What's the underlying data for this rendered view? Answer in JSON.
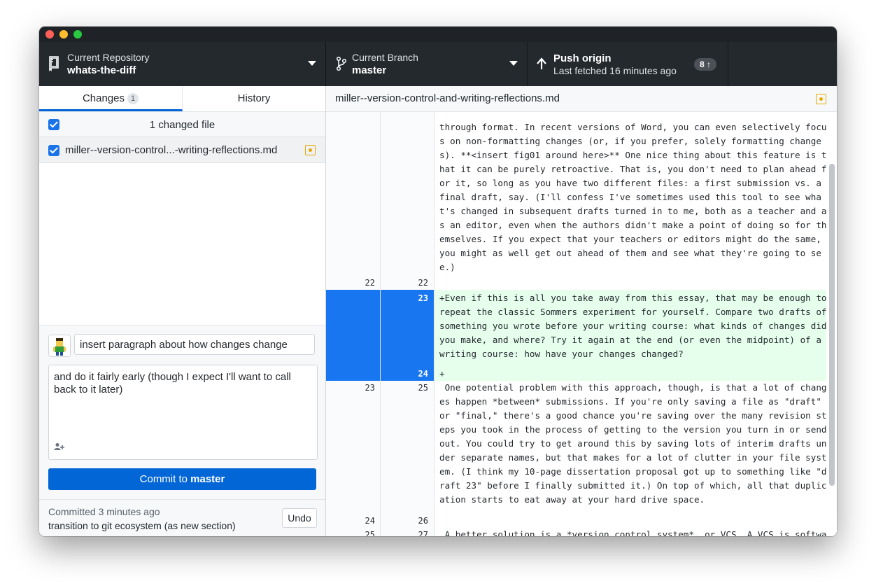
{
  "toolbar": {
    "repo_label": "Current Repository",
    "repo_name": "whats-the-diff",
    "branch_label": "Current Branch",
    "branch_name": "master",
    "push_title": "Push origin",
    "push_subtitle": "Last fetched 16 minutes ago",
    "push_badge": "8 ↑"
  },
  "tabs": {
    "changes": "Changes",
    "changes_count": "1",
    "history": "History"
  },
  "changes": {
    "header": "1 changed file",
    "files": [
      {
        "name": "miller--version-control...-writing-reflections.md",
        "checked": true,
        "status": "modified"
      }
    ]
  },
  "commit": {
    "summary": "insert paragraph about how changes change",
    "description": "and do it fairly early (though I expect I'll want to call back to it later)",
    "button_prefix": "Commit to ",
    "button_branch": "master",
    "last_time": "Committed 3 minutes ago",
    "last_message": "transition to git ecosystem (as new section)",
    "undo": "Undo"
  },
  "diff": {
    "filename": "miller--version-control-and-writing-reflections.md",
    "lines": [
      {
        "old": "",
        "new": "",
        "text": "through format. In recent versions of Word, you can even selectively focu"
      },
      {
        "old": "",
        "new": "",
        "text": "s on non-formatting changes (or, if you prefer, solely formatting change"
      },
      {
        "old": "",
        "new": "",
        "text": "s). **<insert fig01 around here>** One nice thing about this feature is t"
      },
      {
        "old": "",
        "new": "",
        "text": "hat it can be purely retroactive. That is, you don't need to plan ahead f"
      },
      {
        "old": "",
        "new": "",
        "text": "or it, so long as you have two different files: a first submission vs. a"
      },
      {
        "old": "",
        "new": "",
        "text": "final draft, say. (I'll confess I've sometimes used this tool to see wha"
      },
      {
        "old": "",
        "new": "",
        "text": "t's changed in subsequent drafts turned in to me, both as a teacher and a"
      },
      {
        "old": "",
        "new": "",
        "text": "s an editor, even when the authors didn't make a point of doing so for th"
      },
      {
        "old": "",
        "new": "",
        "text": "emselves. If you expect that your teachers or editors might do the same,"
      },
      {
        "old": "",
        "new": "",
        "text": "you might as well get out ahead of them and see what they're going to se"
      },
      {
        "old": "",
        "new": "",
        "text": "e.)"
      },
      {
        "old": "22",
        "new": "22",
        "text": ""
      },
      {
        "old": "",
        "new": "23",
        "text": "+Even if this is all you take away from this essay, that may be enough to"
      },
      {
        "old": "",
        "new": "",
        "text": "repeat the classic Sommers experiment for yourself. Compare two drafts of"
      },
      {
        "old": "",
        "new": "",
        "text": "something you wrote before your writing course: what kinds of changes did"
      },
      {
        "old": "",
        "new": "",
        "text": "you make, and where? Try it again at the end (or even the midpoint) of a"
      },
      {
        "old": "",
        "new": "",
        "text": "writing course: how have your changes changed?"
      },
      {
        "old": "",
        "new": "24",
        "text": "+"
      },
      {
        "old": "23",
        "new": "25",
        "text": " One potential problem with this approach, though, is that a lot of chang"
      },
      {
        "old": "",
        "new": "",
        "text": "es happen *between* submissions. If you're only saving a file as \"draft\""
      },
      {
        "old": "",
        "new": "",
        "text": "or \"final,\" there's a good chance you're saving over the many revision st"
      },
      {
        "old": "",
        "new": "",
        "text": "eps you took in the process of getting to the version you turn in or send"
      },
      {
        "old": "",
        "new": "",
        "text": "out. You could try to get around this by saving lots of interim drafts un"
      },
      {
        "old": "",
        "new": "",
        "text": "der separate names, but that makes for a lot of clutter in your file syst"
      },
      {
        "old": "",
        "new": "",
        "text": "em. (I think my 10-page dissertation proposal got up to something like \"d"
      },
      {
        "old": "",
        "new": "",
        "text": "raft 23\" before I finally submitted it.) On top of which, all that duplic"
      },
      {
        "old": "",
        "new": "",
        "text": "ation starts to eat away at your hard drive space."
      },
      {
        "old": "24",
        "new": "26",
        "text": ""
      },
      {
        "old": "25",
        "new": "27",
        "text": " A better solution is a *version control system*, or VCS. A VCS is softwa"
      }
    ]
  },
  "colors": {
    "accent": "#0366d6",
    "added_bg": "#e6ffed",
    "selected_hunk": "#1976f1",
    "modified": "#e6a700"
  }
}
